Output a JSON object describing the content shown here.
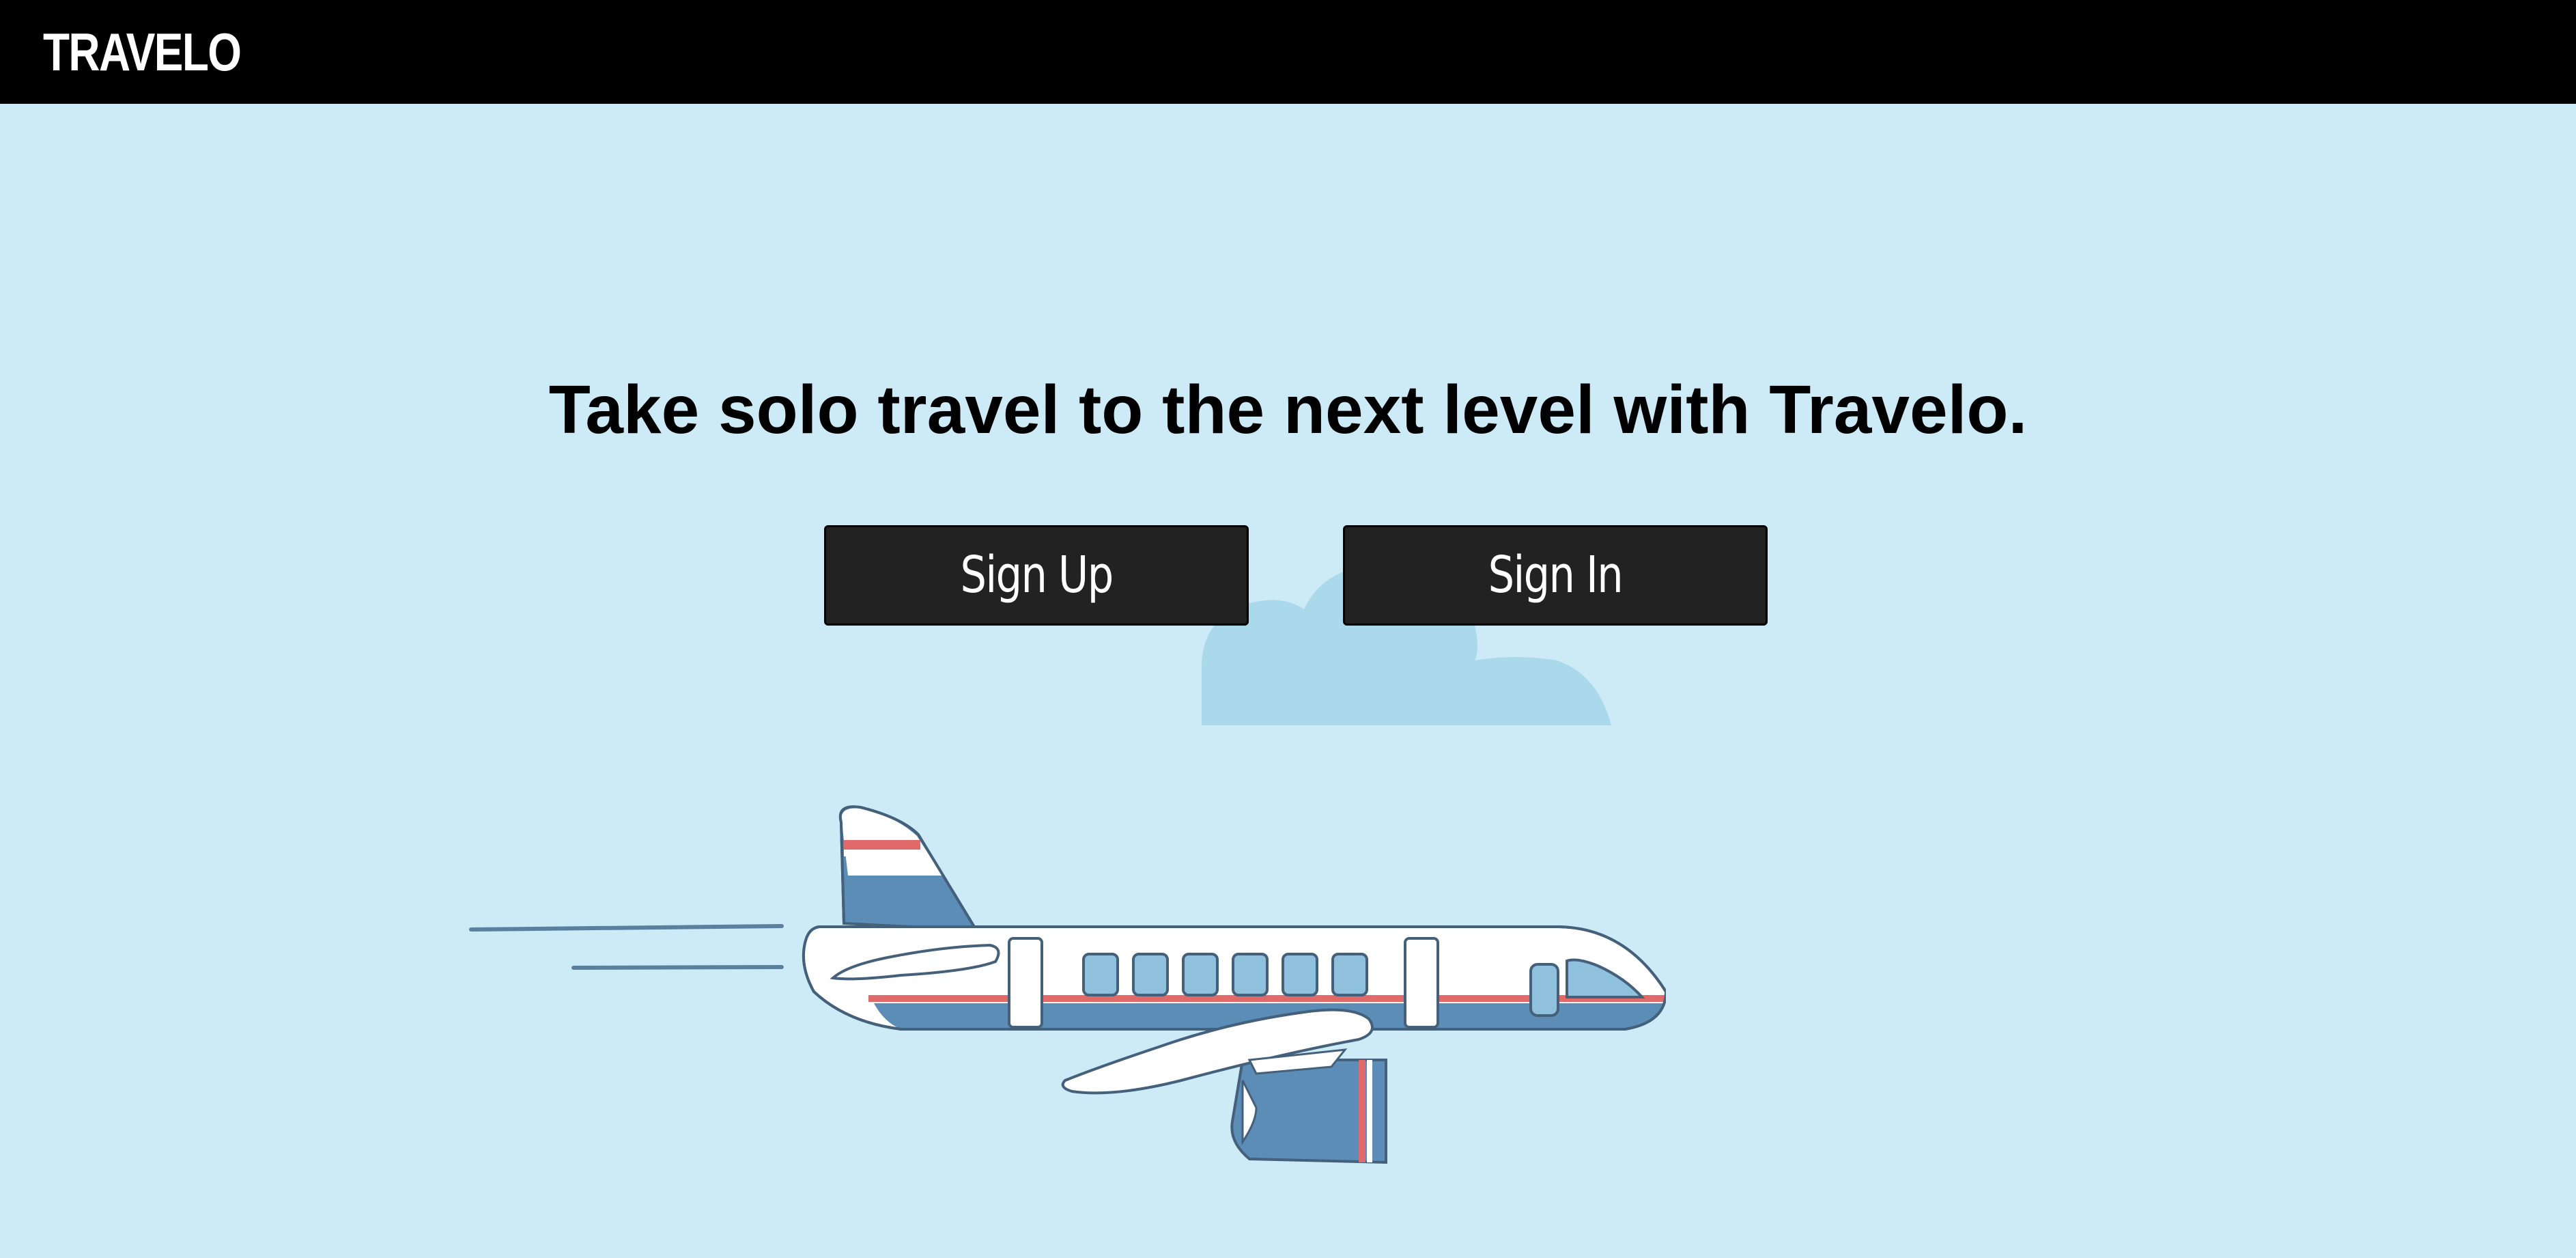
{
  "navbar": {
    "brand": "TRAVELO"
  },
  "hero": {
    "headline": "Take solo travel to the next level with Travelo.",
    "signup_label": "Sign Up",
    "signin_label": "Sign In"
  },
  "colors": {
    "background": "#cdeaf7",
    "navbar": "#000000",
    "button": "#222222",
    "cloud": "#a9d9ea",
    "plane_blue": "#5b8db7",
    "plane_stripe": "#e06a6a",
    "plane_body": "#ffffff"
  },
  "illustrations": [
    "cloud-icon",
    "airplane-icon"
  ]
}
